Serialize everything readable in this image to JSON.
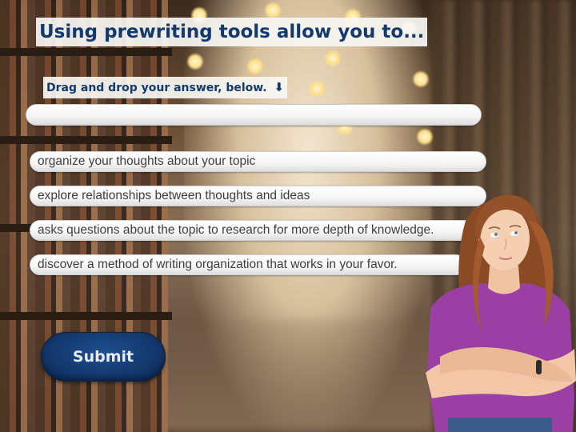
{
  "title": "Using prewriting tools allow you to...",
  "instruction": {
    "text": "Drag and drop your answer, below.",
    "arrow_icon": "down-arrow-icon"
  },
  "dropzone": {
    "value": ""
  },
  "options": [
    "organize your thoughts about your topic",
    "explore relationships between thoughts and ideas",
    "asks questions about the topic to research for more depth of knowledge.",
    "discover a method of writing organization that works in your favor."
  ],
  "submit_label": "Submit",
  "colors": {
    "title_text": "#133a6b",
    "submit_bg": "#143a70",
    "option_text": "#3e3e3e",
    "shirt": "#9b3fa5"
  }
}
